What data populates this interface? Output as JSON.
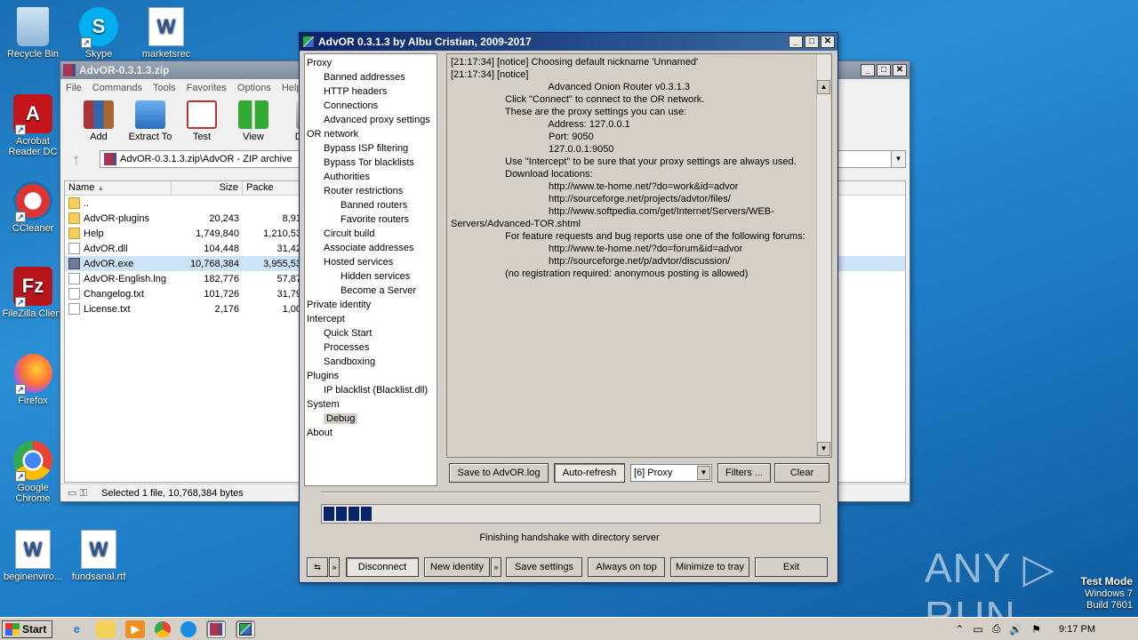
{
  "desktop": {
    "icons": [
      {
        "label": "Recycle Bin"
      },
      {
        "label": "Skype"
      },
      {
        "label": "marketsrec"
      },
      {
        "label": "Acrobat Reader DC"
      },
      {
        "label": "CCleaner"
      },
      {
        "label": "FileZilla Client"
      },
      {
        "label": "Firefox"
      },
      {
        "label": "Google Chrome"
      },
      {
        "label": "beginenviro..."
      },
      {
        "label": "fundsanal.rtf"
      }
    ],
    "watermark": "ANY ▷ RUN",
    "test_mode": {
      "line1": "Test Mode",
      "line2": "Windows 7",
      "line3": "Build 7601"
    }
  },
  "winrar": {
    "title": "AdvOR-0.3.1.3.zip",
    "menu": [
      "File",
      "Commands",
      "Tools",
      "Favorites",
      "Options",
      "Help"
    ],
    "toolbar": [
      "Add",
      "Extract To",
      "Test",
      "View",
      "Dele"
    ],
    "address": "AdvOR-0.3.1.3.zip\\AdvOR - ZIP archive",
    "columns": {
      "name": "Name",
      "size": "Size",
      "packed": "Packe"
    },
    "rows": [
      {
        "name": "..",
        "size": "",
        "packed": ""
      },
      {
        "name": "AdvOR-plugins",
        "size": "20,243",
        "packed": "8,91"
      },
      {
        "name": "Help",
        "size": "1,749,840",
        "packed": "1,210,53"
      },
      {
        "name": "AdvOR.dll",
        "size": "104,448",
        "packed": "31,42"
      },
      {
        "name": "AdvOR.exe",
        "size": "10,768,384",
        "packed": "3,955,53"
      },
      {
        "name": "AdvOR-English.lng",
        "size": "182,776",
        "packed": "57,87"
      },
      {
        "name": "Changelog.txt",
        "size": "101,726",
        "packed": "31,79"
      },
      {
        "name": "License.txt",
        "size": "2,176",
        "packed": "1,00"
      }
    ],
    "status": "Selected 1 file, 10,768,384 bytes"
  },
  "advor": {
    "title": "AdvOR  0.3.1.3 by Albu Cristian, 2009-2017",
    "tree": [
      {
        "label": "Proxy",
        "level": 1
      },
      {
        "label": "Banned addresses",
        "level": 2
      },
      {
        "label": "HTTP headers",
        "level": 2
      },
      {
        "label": "Connections",
        "level": 2
      },
      {
        "label": "Advanced proxy settings",
        "level": 2
      },
      {
        "label": "OR network",
        "level": 1
      },
      {
        "label": "Bypass ISP filtering",
        "level": 2
      },
      {
        "label": "Bypass Tor blacklists",
        "level": 2
      },
      {
        "label": "Authorities",
        "level": 2
      },
      {
        "label": "Router restrictions",
        "level": 2
      },
      {
        "label": "Banned routers",
        "level": 3
      },
      {
        "label": "Favorite routers",
        "level": 3
      },
      {
        "label": "Circuit build",
        "level": 2
      },
      {
        "label": "Associate addresses",
        "level": 2
      },
      {
        "label": "Hosted services",
        "level": 2
      },
      {
        "label": "Hidden services",
        "level": 3
      },
      {
        "label": "Become a Server",
        "level": 3
      },
      {
        "label": "Private identity",
        "level": 1
      },
      {
        "label": "Intercept",
        "level": 1
      },
      {
        "label": "Quick Start",
        "level": 2
      },
      {
        "label": "Processes",
        "level": 2
      },
      {
        "label": "Sandboxing",
        "level": 2
      },
      {
        "label": "Plugins",
        "level": 1
      },
      {
        "label": "IP blacklist (Blacklist.dll)",
        "level": 2
      },
      {
        "label": "System",
        "level": 1
      },
      {
        "label": "Debug",
        "level": 2,
        "selected": true
      },
      {
        "label": "About",
        "level": 1
      }
    ],
    "log": [
      "[21:17:34] [notice] Choosing default nickname 'Unnamed'",
      "[21:17:34] [notice]",
      "",
      "                                    Advanced Onion Router v0.3.1.3",
      "",
      "                    Click \"Connect\" to connect to the OR network.",
      "                    These are the proxy settings you can use:",
      "                                    Address: 127.0.0.1",
      "                                    Port: 9050",
      "                                    127.0.0.1:9050",
      "                    Use \"Intercept\" to be sure that your proxy settings are always used.",
      "",
      "                    Download locations:",
      "                                    http://www.te-home.net/?do=work&id=advor",
      "                                    http://sourceforge.net/projects/advtor/files/",
      "                                    http://www.softpedia.com/get/Internet/Servers/WEB-",
      "Servers/Advanced-TOR.shtml",
      "                    For feature requests and bug reports use one of the following forums:",
      "                                    http://www.te-home.net/?do=forum&id=advor",
      "                                    http://sourceforge.net/p/advtor/discussion/",
      "                    (no registration required: anonymous posting is allowed)"
    ],
    "buttons": {
      "save_log": "Save to AdvOR.log",
      "auto_refresh": "Auto-refresh",
      "filter_value": "[6] Proxy",
      "filters": "Filters ...",
      "clear": "Clear",
      "disconnect": "Disconnect",
      "new_identity": "New identity",
      "save_settings": "Save settings",
      "always_on_top": "Always on top",
      "minimize_to_tray": "Minimize to tray",
      "exit": "Exit"
    },
    "progress_fraction": 0.1,
    "status": "Finishing handshake with directory server"
  },
  "taskbar": {
    "start": "Start",
    "clock": "9:17 PM"
  }
}
